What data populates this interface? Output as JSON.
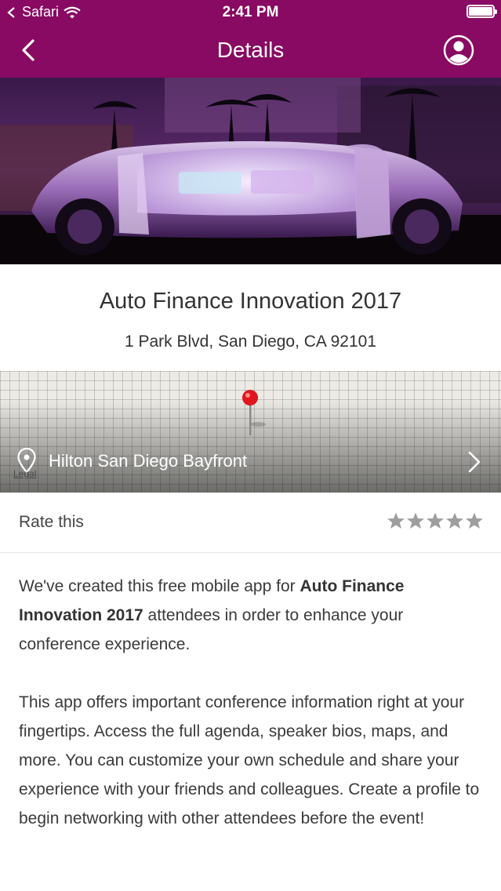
{
  "status_bar": {
    "carrier": "Safari",
    "time": "2:41 PM"
  },
  "nav": {
    "title": "Details",
    "back_icon": "chevron-left-icon",
    "profile_icon": "user-circle-icon"
  },
  "event": {
    "title": "Auto Finance Innovation 2017",
    "address": "1 Park Blvd, San Diego, CA 92101"
  },
  "map": {
    "venue": "Hilton San Diego Bayfront",
    "legal_label": "Legal"
  },
  "rating": {
    "label": "Rate this",
    "stars_total": 5,
    "stars_filled": 0
  },
  "description": {
    "p1_pre": "We've created this free mobile app for ",
    "p1_bold": "Auto Finance Innovation 2017",
    "p1_post": " attendees in order to enhance your conference experience.",
    "p2": "This app offers important conference information right at your fingertips. Access the full agenda, speaker bios, maps, and more. You can customize your own schedule and share your experience with your friends and colleagues. Create a profile to begin networking with other attendees before the event!"
  },
  "colors": {
    "brand": "#880a62",
    "star_empty": "#9e9e9e",
    "pin": "#e0161e"
  }
}
